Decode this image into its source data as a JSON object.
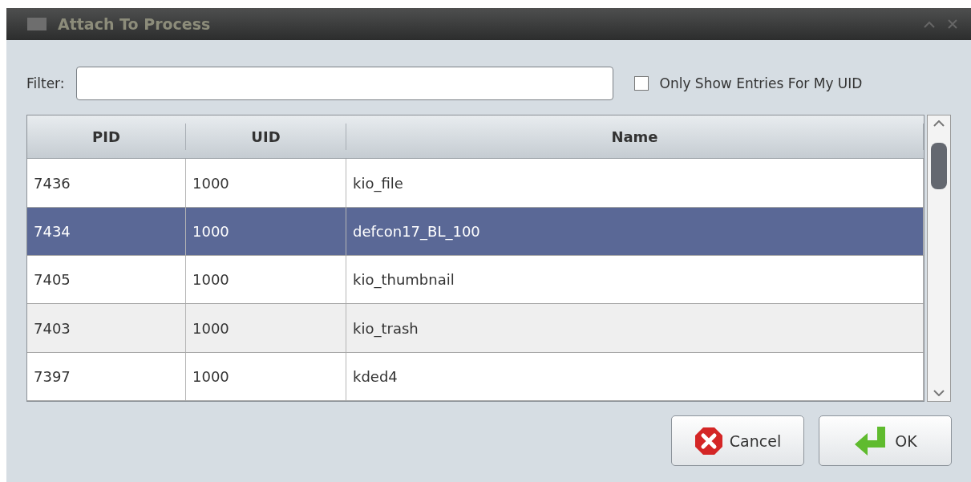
{
  "window": {
    "title": "Attach To Process"
  },
  "filter": {
    "label": "Filter:"
  },
  "only_my_uid": {
    "label": "Only Show Entries For My UID",
    "checked": false
  },
  "table": {
    "columns": [
      "PID",
      "UID",
      "Name"
    ],
    "rows": [
      {
        "pid": "7436",
        "uid": "1000",
        "name": "kio_file",
        "selected": false
      },
      {
        "pid": "7434",
        "uid": "1000",
        "name": "defcon17_BL_100",
        "selected": true
      },
      {
        "pid": "7405",
        "uid": "1000",
        "name": "kio_thumbnail",
        "selected": false
      },
      {
        "pid": "7403",
        "uid": "1000",
        "name": "kio_trash",
        "selected": false
      },
      {
        "pid": "7397",
        "uid": "1000",
        "name": "kded4",
        "selected": false
      }
    ]
  },
  "buttons": [
    {
      "kind": "cancel",
      "label": "Cancel"
    },
    {
      "kind": "ok",
      "label": "OK"
    }
  ]
}
